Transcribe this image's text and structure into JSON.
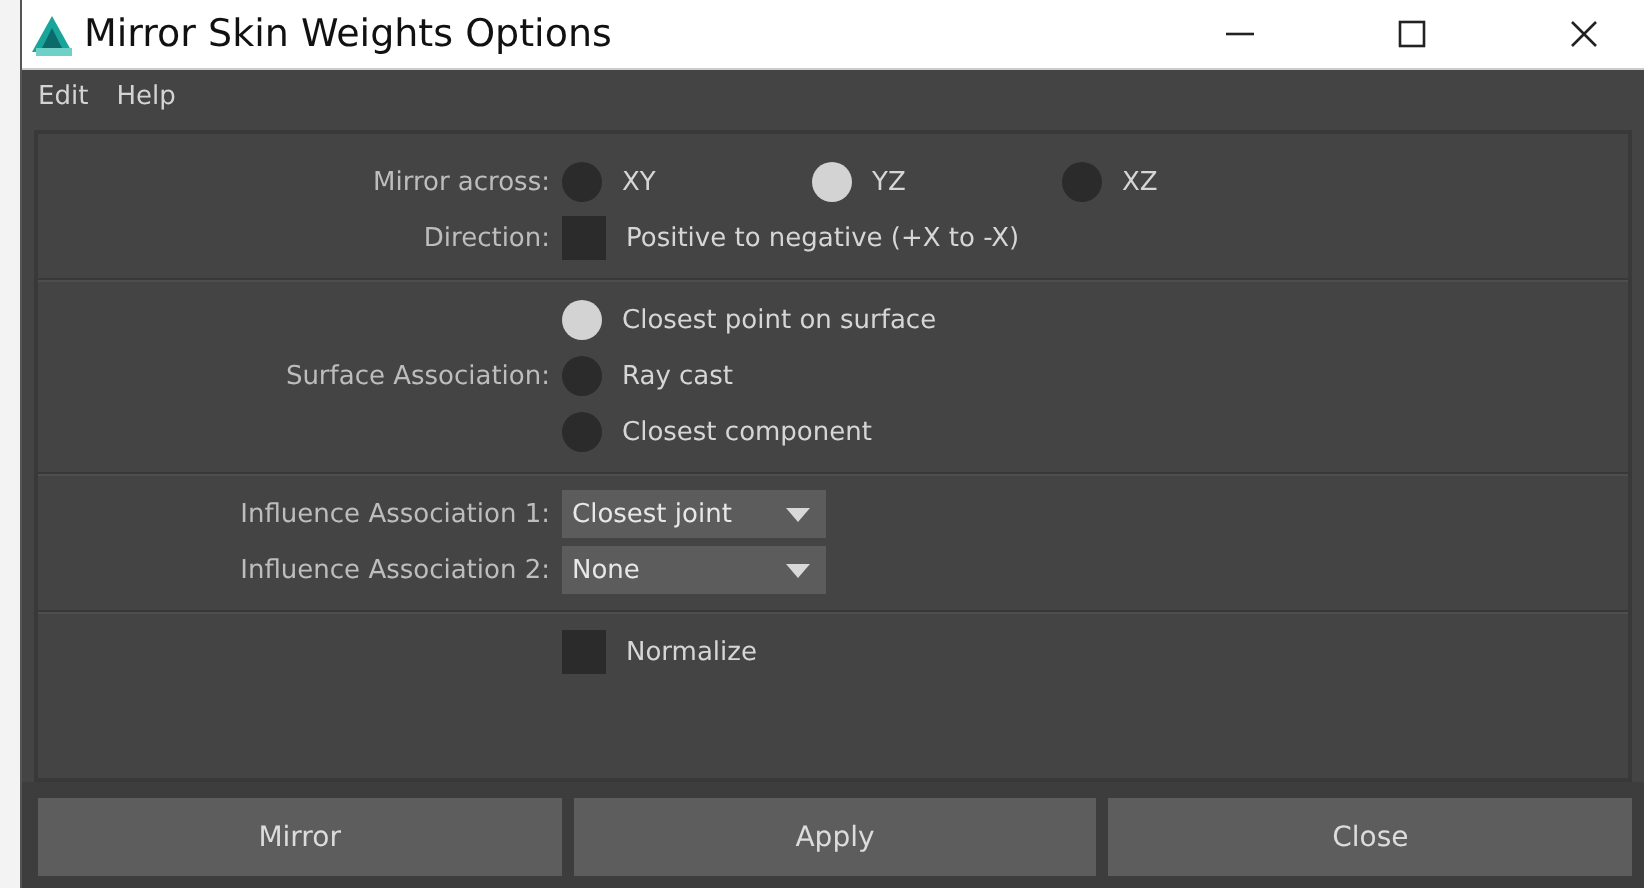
{
  "window": {
    "title": "Mirror Skin Weights Options"
  },
  "menu": [
    {
      "label": "Edit"
    },
    {
      "label": "Help"
    }
  ],
  "sections": [
    {
      "rows": [
        {
          "kind": "radio-row",
          "label": "Mirror across:",
          "options": [
            {
              "label": "XY",
              "selected": false
            },
            {
              "label": "YZ",
              "selected": true
            },
            {
              "label": "XZ",
              "selected": false
            }
          ]
        },
        {
          "kind": "checkbox",
          "label": "Direction:",
          "text": "Positive to negative (+X to -X)",
          "checked": false
        }
      ]
    },
    {
      "rows": [
        {
          "kind": "radio-column",
          "label": "Surface Association:",
          "options": [
            {
              "label": "Closest point on surface",
              "selected": true
            },
            {
              "label": "Ray cast",
              "selected": false
            },
            {
              "label": "Closest component",
              "selected": false
            }
          ]
        }
      ]
    },
    {
      "rows": [
        {
          "kind": "dropdown",
          "label": "Influence Association 1:",
          "value": "Closest joint"
        },
        {
          "kind": "dropdown",
          "label": "Influence Association 2:",
          "value": "None"
        }
      ]
    },
    {
      "rows": [
        {
          "kind": "checkbox",
          "text": "Normalize",
          "checked": false
        }
      ]
    }
  ],
  "buttons": [
    "Mirror",
    "Apply",
    "Close"
  ]
}
